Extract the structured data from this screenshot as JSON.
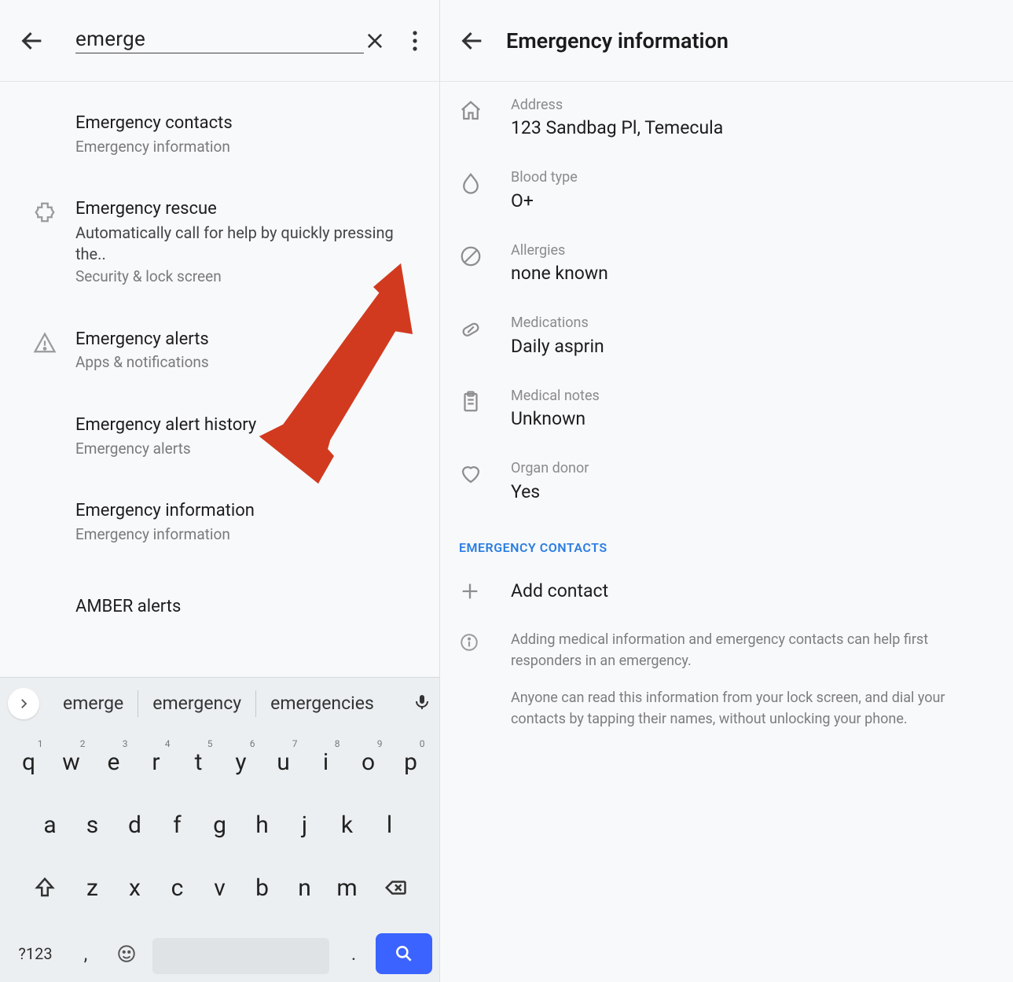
{
  "left": {
    "search_query": "emerge",
    "results": [
      {
        "title": "Emergency contacts",
        "sub": "Emergency information"
      },
      {
        "title": "Emergency rescue",
        "desc": "Automatically call for help by quickly pressing the..",
        "sub": "Security & lock screen",
        "icon": "medical"
      },
      {
        "title": "Emergency alerts",
        "sub": "Apps & notifications",
        "icon": "alert"
      },
      {
        "title": "Emergency alert history",
        "sub": "Emergency alerts"
      },
      {
        "title": "Emergency information",
        "sub": "Emergency information"
      },
      {
        "title": "AMBER alerts"
      }
    ],
    "suggestions": [
      "emerge",
      "emergency",
      "emergencies"
    ],
    "keyboard": {
      "row1": [
        "q",
        "w",
        "e",
        "r",
        "t",
        "y",
        "u",
        "i",
        "o",
        "p"
      ],
      "row1_sup": [
        "1",
        "2",
        "3",
        "4",
        "5",
        "6",
        "7",
        "8",
        "9",
        "0"
      ],
      "row2": [
        "a",
        "s",
        "d",
        "f",
        "g",
        "h",
        "j",
        "k",
        "l"
      ],
      "row3": [
        "z",
        "x",
        "c",
        "v",
        "b",
        "n",
        "m"
      ],
      "sym_label": "?123",
      "comma": ",",
      "dot": "."
    }
  },
  "right": {
    "title": "Emergency information",
    "items": [
      {
        "label": "Address",
        "value": "123 Sandbag Pl, Temecula",
        "icon": "home"
      },
      {
        "label": "Blood type",
        "value": "O+",
        "icon": "blood"
      },
      {
        "label": "Allergies",
        "value": "none known",
        "icon": "prohibit"
      },
      {
        "label": "Medications",
        "value": "Daily asprin",
        "icon": "pill"
      },
      {
        "label": "Medical notes",
        "value": "Unknown",
        "icon": "clipboard"
      },
      {
        "label": "Organ donor",
        "value": "Yes",
        "icon": "heart"
      }
    ],
    "section": "EMERGENCY CONTACTS",
    "add_contact": "Add contact",
    "help1": "Adding medical information and emergency contacts can help first responders in an emergency.",
    "help2": "Anyone can read this information from your lock screen, and dial your contacts by tapping their names, without unlocking your phone."
  }
}
